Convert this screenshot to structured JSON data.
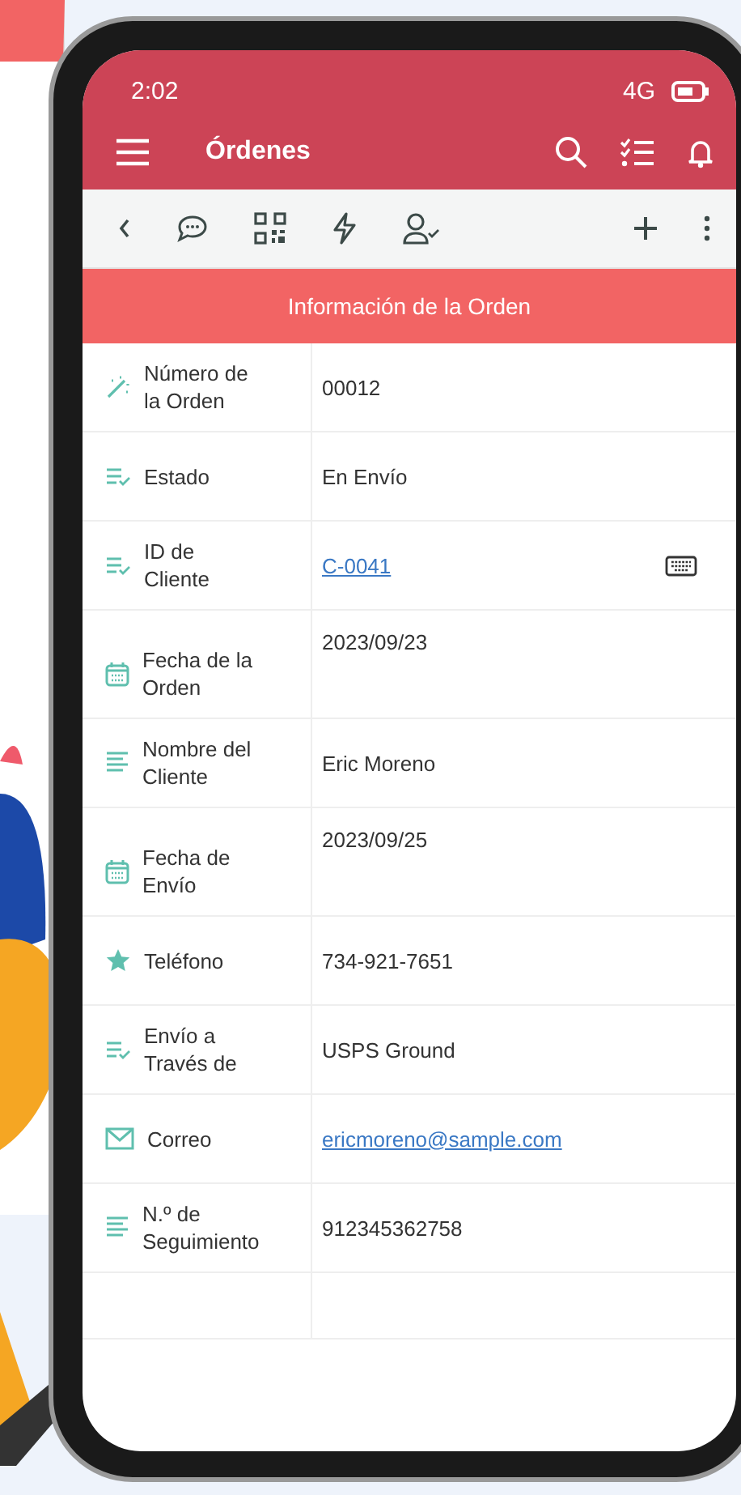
{
  "status_bar": {
    "time": "2:02",
    "network": "4G"
  },
  "app_bar": {
    "title": "Órdenes"
  },
  "section_title": "Información de la Orden",
  "fields": [
    {
      "kind": "autonumber",
      "label": "Número de la Orden",
      "value": "00012",
      "link": false,
      "keyboard": false
    },
    {
      "kind": "choice",
      "label": "Estado",
      "value": "En Envío",
      "link": false,
      "keyboard": false
    },
    {
      "kind": "choice",
      "label": "ID de Cliente",
      "value": "C-0041",
      "link": true,
      "keyboard": true
    },
    {
      "kind": "date",
      "label": "Fecha de la Orden",
      "value": "2023/09/23",
      "link": false,
      "keyboard": false
    },
    {
      "kind": "text",
      "label": "Nombre del Cliente",
      "value": "Eric Moreno",
      "link": false,
      "keyboard": false
    },
    {
      "kind": "date",
      "label": "Fecha de Envío",
      "value": "2023/09/25",
      "link": false,
      "keyboard": false
    },
    {
      "kind": "rating",
      "label": "Teléfono",
      "value": "734-921-7651",
      "link": false,
      "keyboard": false
    },
    {
      "kind": "choice",
      "label": "Envío a Través de",
      "value": "USPS Ground",
      "link": false,
      "keyboard": false
    },
    {
      "kind": "email",
      "label": "Correo",
      "value": "ericmoreno@sample.com",
      "link": true,
      "keyboard": false
    },
    {
      "kind": "text",
      "label": "N.º de Seguimiento",
      "value": "912345362758",
      "link": false,
      "keyboard": false
    }
  ]
}
